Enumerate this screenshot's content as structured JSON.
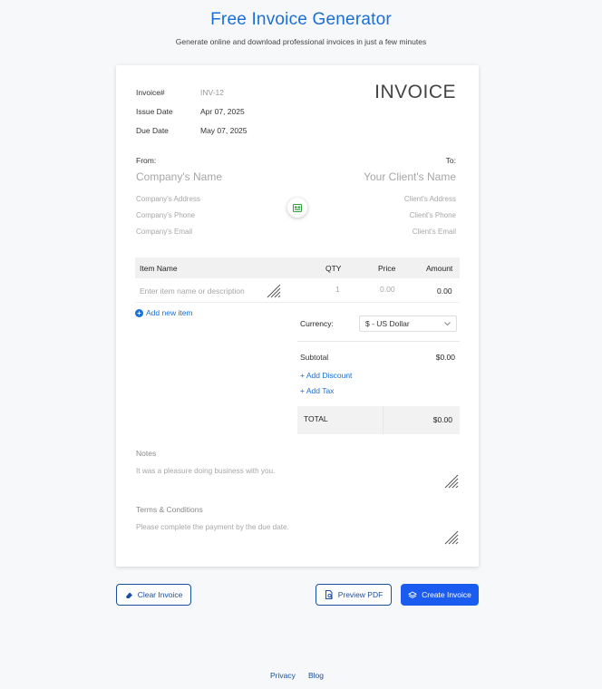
{
  "header": {
    "title": "Free Invoice Generator",
    "subtitle": "Generate online and download professional invoices in just a few minutes"
  },
  "invoice": {
    "heading": "INVOICE",
    "number_label": "Invoice#",
    "number_value": "INV-12",
    "issue_label": "Issue Date",
    "issue_value": "Apr 07, 2025",
    "due_label": "Due Date",
    "due_value": "May 07, 2025"
  },
  "from": {
    "label": "From:",
    "name_placeholder": "Company's Name",
    "address_placeholder": "Company's Address",
    "phone_placeholder": "Company's Phone",
    "email_placeholder": "Company's Email"
  },
  "to": {
    "label": "To:",
    "name_placeholder": "Your Client's Name",
    "address_placeholder": "Client's Address",
    "phone_placeholder": "Client's Phone",
    "email_placeholder": "Client's Email"
  },
  "items_table": {
    "headers": [
      "Item Name",
      "QTY",
      "Price",
      "Amount"
    ],
    "rows": [
      {
        "name_placeholder": "Enter item name or description",
        "qty": "1",
        "price": "0.00",
        "amount": "0.00"
      }
    ],
    "add_label": "Add new item"
  },
  "summary": {
    "currency_label": "Currency:",
    "currency_value": "$ - US Dollar",
    "subtotal_label": "Subtotal",
    "subtotal_value": "$0.00",
    "add_discount": "+ Add Discount",
    "add_tax": "+ Add Tax",
    "total_label": "TOTAL",
    "total_value": "$0.00"
  },
  "notes": {
    "label": "Notes",
    "placeholder": "It was a pleasure doing business with you."
  },
  "terms": {
    "label": "Terms & Conditions",
    "placeholder": "Please complete the payment by the due date."
  },
  "actions": {
    "clear": "Clear Invoice",
    "preview": "Preview PDF",
    "create": "Create Invoice"
  },
  "footer": {
    "privacy": "Privacy",
    "blog": "Blog"
  },
  "colors": {
    "brand": "#1a6fd6",
    "primary_button": "#1a5cf0",
    "center_icon": "#2e9d3a"
  },
  "icons": [
    "card-icon",
    "plus-circle-icon",
    "chevron-down-icon",
    "resize-handle-icon",
    "eraser-icon",
    "pdf-preview-icon",
    "layers-icon"
  ]
}
